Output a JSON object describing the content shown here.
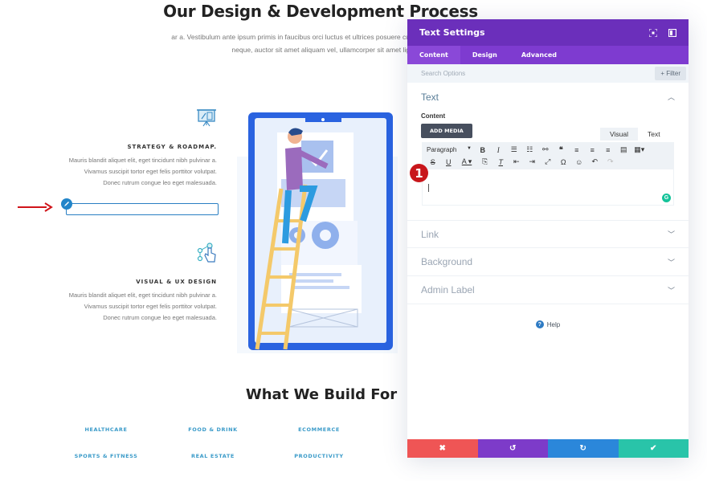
{
  "page": {
    "title": "Our Design & Development Process",
    "intro_lines": [
      "ar a. Vestibulum ante ipsum primis in faucibus orci luctus et ultrices posuere cu",
      "neque, auctor sit amet aliquam vel, ullamcorper sit amet lig"
    ],
    "features": [
      {
        "icon": "presentation-board-icon",
        "title": "STRATEGY & ROADMAP.",
        "lines": [
          "Mauris blandit aliquet elit, eget tincidunt nibh pulvinar a.",
          "Vivamus suscipit tortor eget felis porttitor volutpat.",
          "Donec rutrum congue leo eget malesuada."
        ]
      },
      {
        "icon": "touch-network-icon",
        "title": "VISUAL & UX DESIGN",
        "lines": [
          "Mauris blandit aliquet elit, eget tincidunt nibh pulvinar a.",
          "Vivamus suscipit tortor eget felis porttitor volutpat.",
          "Donec rutrum congue leo eget malesuada."
        ]
      }
    ],
    "section2_title": "What We Build For",
    "industries": [
      [
        "HEALTHCARE",
        "FOOD & DRINK",
        "ECOMMERCE"
      ],
      [
        "SPORTS & FITNESS",
        "REAL ESTATE",
        "PRODUCTIVITY"
      ]
    ]
  },
  "annotation": {
    "step_number": "1",
    "arrow_color": "#d0141a"
  },
  "modal": {
    "title": "Text Settings",
    "header_icons": [
      "focus-icon",
      "sidebar-toggle-icon"
    ],
    "tabs": [
      "Content",
      "Design",
      "Advanced"
    ],
    "active_tab": "Content",
    "search_placeholder": "Search Options",
    "filter_label": "+ Filter",
    "sections": {
      "text": {
        "title": "Text",
        "content_label": "Content",
        "add_media_label": "ADD MEDIA",
        "editor_tabs": [
          "Visual",
          "Text"
        ],
        "format_select": "Paragraph",
        "toolbar_row1": [
          "bold",
          "italic",
          "bulleted-list",
          "numbered-list",
          "link",
          "blockquote",
          "align-left",
          "align-center",
          "align-right",
          "justify",
          "table"
        ],
        "toolbar_row2": [
          "strikethrough",
          "underline",
          "text-color",
          "paste-as-text",
          "clear-formatting",
          "outdent",
          "indent",
          "fullscreen",
          "special-character",
          "emoji",
          "undo",
          "redo"
        ],
        "content_value": ""
      },
      "collapsed": [
        "Link",
        "Background",
        "Admin Label"
      ]
    },
    "help_label": "Help",
    "footer": {
      "buttons": [
        {
          "name": "cancel",
          "glyph": "✖",
          "color": "#ef5555"
        },
        {
          "name": "undo",
          "glyph": "↺",
          "color": "#7d3bc9"
        },
        {
          "name": "redo",
          "glyph": "↻",
          "color": "#2b87da"
        },
        {
          "name": "save",
          "glyph": "✔",
          "color": "#29c4a9"
        }
      ]
    },
    "colors": {
      "header": "#6b2fbb",
      "tabs": "#7e3bd0"
    }
  }
}
